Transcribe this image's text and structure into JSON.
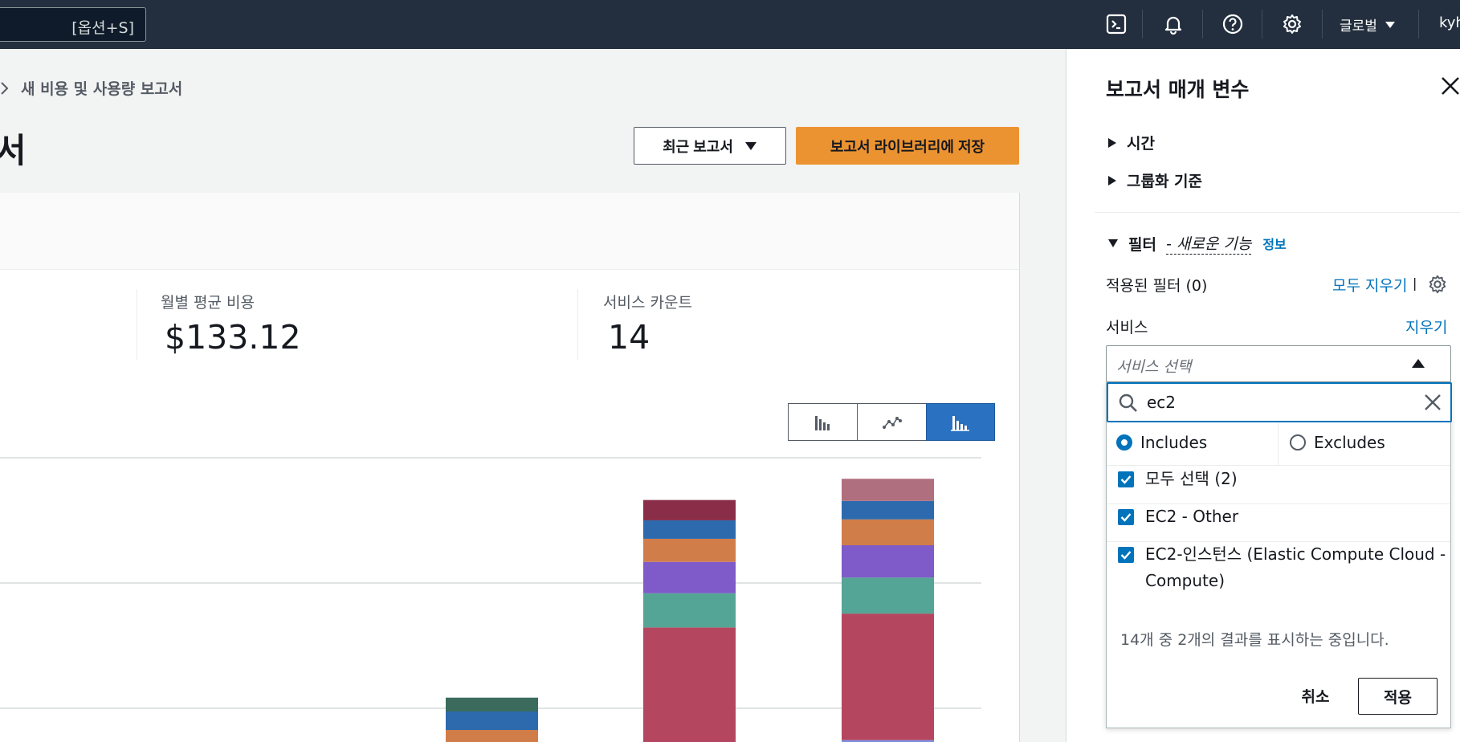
{
  "topnav": {
    "search_shortcut": "[옵션+S]",
    "icons": [
      "cloudshell-icon",
      "bell-icon",
      "help-icon",
      "settings-icon"
    ],
    "region": "글로벌",
    "user": "kyh"
  },
  "breadcrumb": {
    "label": "새 비용 및 사용량 보고서"
  },
  "page": {
    "title_fragment": "서",
    "recent_reports_label": "최근 보고서",
    "save_library_label": "보고서 라이브러리에 저장"
  },
  "stats": {
    "monthly_avg_label": "월별 평균 비용",
    "monthly_avg_value": "$133.12",
    "service_count_label": "서비스 카운트",
    "service_count_value": "14"
  },
  "chart_type_buttons": [
    "bar-chart-icon",
    "line-chart-icon",
    "stacked-bar-chart-icon"
  ],
  "colors": {
    "accent": "#0073bb",
    "save_button": "#ec9331",
    "active_toggle": "#2a71c2",
    "nav_bg": "#232f3e"
  },
  "chart_data": {
    "type": "bar",
    "stacked": true,
    "note_colors": [
      "#b4475f",
      "#55a596",
      "#7e5bc8",
      "#d17d4a",
      "#2d6aad",
      "#8a2d48",
      "#3a6b5d",
      "#b06f7e",
      "#7c8fe0"
    ],
    "bars": [
      {
        "segments": [
          {
            "color": "#d17d4a",
            "height": 0.2
          },
          {
            "color": "#2d6aad",
            "height": 0.2
          },
          {
            "color": "#3a6b5d",
            "height": 0.15
          }
        ]
      },
      {
        "segments": [
          {
            "color": "#7c8fe0",
            "height": 0.03
          },
          {
            "color": "#b4475f",
            "height": 1.28
          },
          {
            "color": "#55a596",
            "height": 0.37
          },
          {
            "color": "#7e5bc8",
            "height": 0.34
          },
          {
            "color": "#d17d4a",
            "height": 0.25
          },
          {
            "color": "#2d6aad",
            "height": 0.2
          },
          {
            "color": "#8a2d48",
            "height": 0.22
          }
        ]
      },
      {
        "segments": [
          {
            "color": "#7c8fe0",
            "height": 0.09
          },
          {
            "color": "#b4475f",
            "height": 1.37
          },
          {
            "color": "#55a596",
            "height": 0.39
          },
          {
            "color": "#7e5bc8",
            "height": 0.35
          },
          {
            "color": "#d17d4a",
            "height": 0.28
          },
          {
            "color": "#2d6aad",
            "height": 0.2
          },
          {
            "color": "#b06f7e",
            "height": 0.24
          }
        ]
      }
    ],
    "grid": true
  },
  "panel": {
    "title": "보고서 매개 변수",
    "sections": {
      "time": "시간",
      "group_by": "그룹화 기준"
    },
    "filter_label": "필터",
    "filter_new": "- 새로운 기능",
    "info": "정보",
    "applied_filters": "적용된 필터 (0)",
    "clear_all": "모두 지우기",
    "pipe": "|",
    "service_label": "서비스",
    "service_clear": "지우기",
    "service_placeholder": "서비스 선택",
    "search_value": "ec2",
    "includes": "Includes",
    "excludes": "Excludes",
    "options": [
      {
        "label": "모두 선택 (2)",
        "checked": true
      },
      {
        "label": "EC2 - Other",
        "checked": true
      },
      {
        "label_line1": "EC2-인스턴스 (Elastic Compute Cloud -",
        "label_line2": "Compute)",
        "checked": true
      }
    ],
    "results_text": "14개 중 2개의 결과를 표시하는 중입니다.",
    "cancel": "취소",
    "apply": "적용",
    "handle": "II"
  }
}
